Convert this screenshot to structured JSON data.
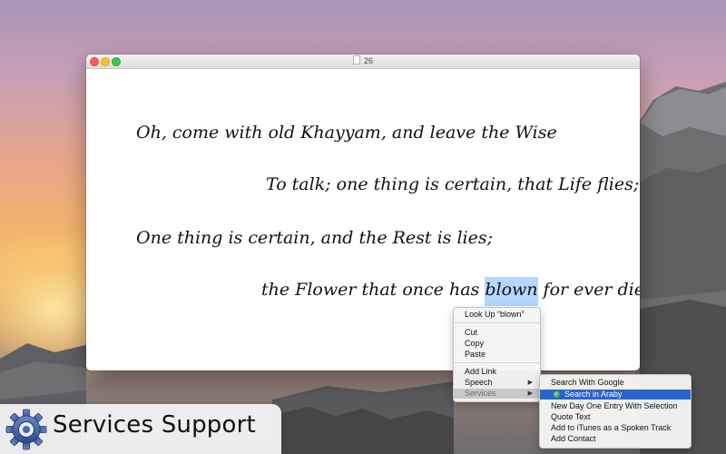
{
  "window": {
    "title": "26",
    "controls": {
      "close": "close-button",
      "minimize": "minimize-button",
      "zoom": "zoom-button"
    }
  },
  "poem": {
    "line1": "Oh,  come with old Khayyam, and leave the Wise",
    "line2": "To talk; one thing is certain, that Life flies;",
    "line3": "One thing is certain, and the Rest is lies;",
    "line4_before": "the Flower that once has ",
    "line4_selected": "blown",
    "line4_after": " for ever dies"
  },
  "context_menu": {
    "items": [
      {
        "label": "Look Up “blown”"
      },
      {
        "label": "Cut"
      },
      {
        "label": "Copy"
      },
      {
        "label": "Paste"
      },
      {
        "label": "Add Link"
      },
      {
        "label": "Speech",
        "submenu": true
      },
      {
        "label": "Services",
        "submenu": true,
        "active": true
      }
    ]
  },
  "services_submenu": {
    "items": [
      {
        "label": "Search With Google"
      },
      {
        "label": "Search in Araby",
        "highlighted": true,
        "icon": "araby-icon"
      },
      {
        "label": "New Day One Entry With Selection"
      },
      {
        "label": "Quote Text"
      },
      {
        "label": "Add to iTunes as a Spoken Track"
      },
      {
        "label": "Add Contact"
      }
    ]
  },
  "badge": {
    "icon": "gear-icon",
    "text": "Services Support"
  },
  "colors": {
    "selection": "#b5d6ff",
    "menu_highlight": "#2b64ce",
    "traffic_close": "#fb5e56",
    "traffic_minimize": "#fdbd2f",
    "traffic_zoom": "#36ca44"
  }
}
